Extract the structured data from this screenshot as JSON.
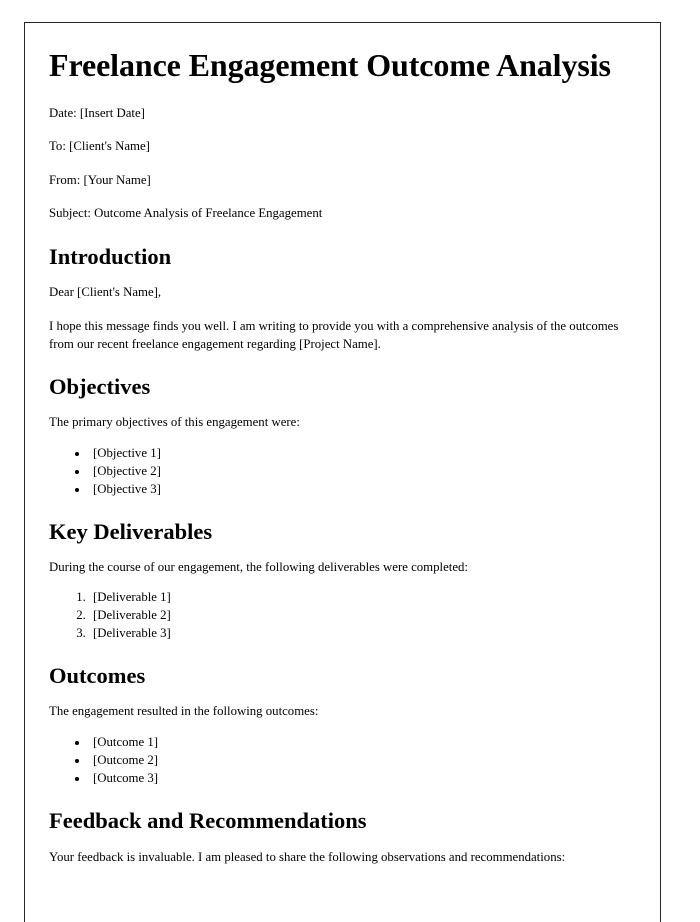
{
  "document": {
    "title": "Freelance Engagement Outcome Analysis",
    "meta": [
      "Date: [Insert Date]",
      "To: [Client's Name]",
      "From: [Your Name]",
      "Subject: Outcome Analysis of Freelance Engagement"
    ],
    "sections": [
      {
        "heading": "Introduction",
        "salutation": "Dear [Client's Name],",
        "paragraph": "I hope this message finds you well. I am writing to provide you with a comprehensive analysis of the outcomes from our recent freelance engagement regarding [Project Name]."
      },
      {
        "heading": "Objectives",
        "intro": "The primary objectives of this engagement were:",
        "list_type": "bullet",
        "items": [
          "[Objective 1]",
          "[Objective 2]",
          "[Objective 3]"
        ]
      },
      {
        "heading": "Key Deliverables",
        "intro": "During the course of our engagement, the following deliverables were completed:",
        "list_type": "numbered",
        "items": [
          "[Deliverable 1]",
          "[Deliverable 2]",
          "[Deliverable 3]"
        ]
      },
      {
        "heading": "Outcomes",
        "intro": "The engagement resulted in the following outcomes:",
        "list_type": "bullet",
        "items": [
          "[Outcome 1]",
          "[Outcome 2]",
          "[Outcome 3]"
        ]
      },
      {
        "heading": "Feedback and Recommendations",
        "intro": "Your feedback is invaluable. I am pleased to share the following observations and recommendations:"
      }
    ]
  },
  "colors": {
    "page_background": "#ffffff",
    "canvas_background": "#ffffff",
    "page_border": "#262626",
    "text": "#000000"
  }
}
